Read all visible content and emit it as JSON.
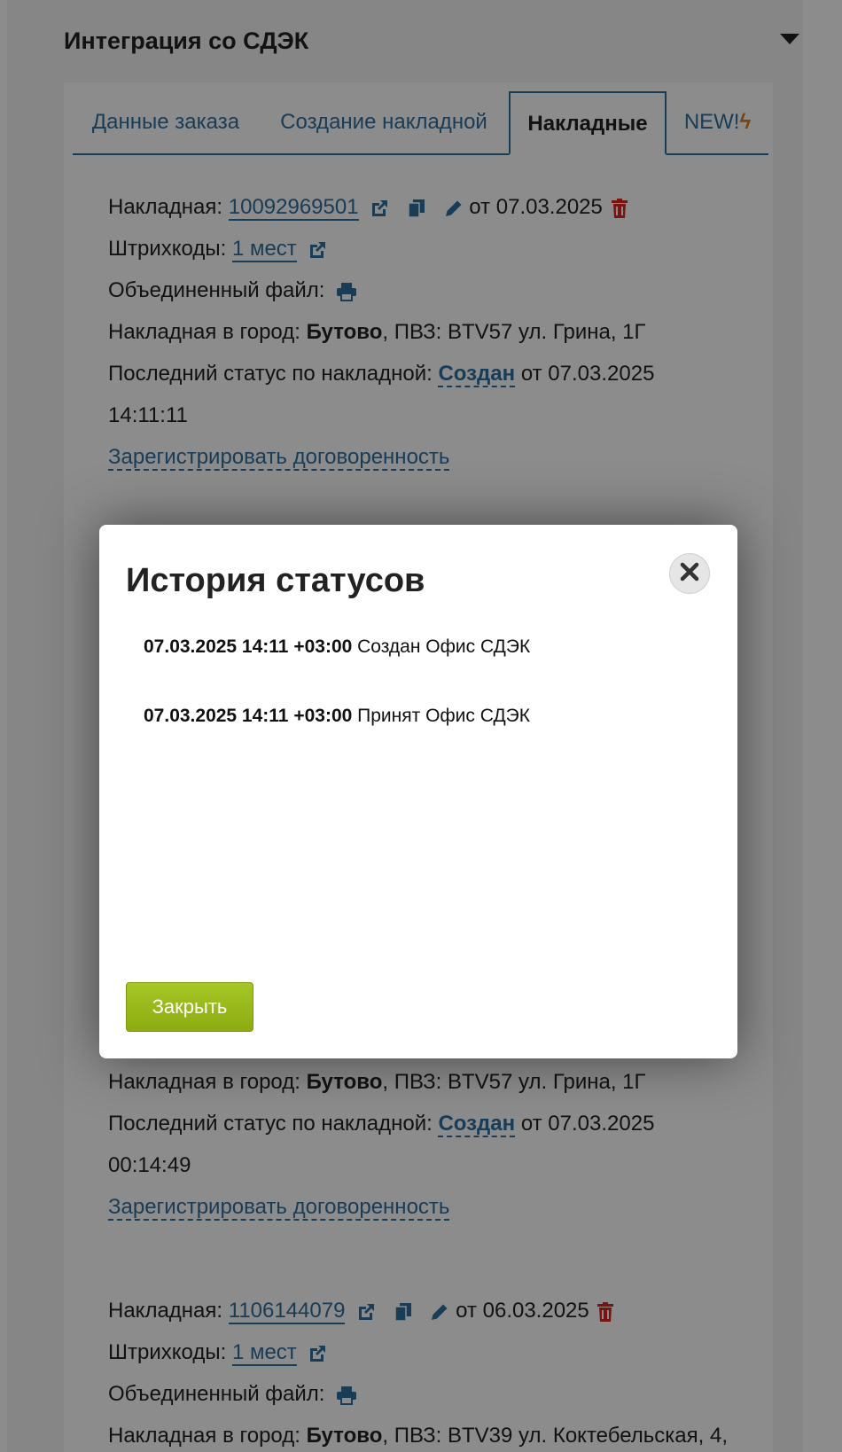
{
  "panel": {
    "title": "Интеграция со СДЭК"
  },
  "tabs": [
    {
      "label": "Данные заказа"
    },
    {
      "label": "Создание накладной"
    },
    {
      "label": "Накладные"
    },
    {
      "label": "NEW!"
    }
  ],
  "waybill1": {
    "label": "Накладная:",
    "number": "10092969501",
    "date_text": "от 07.03.2025",
    "barcodes_label": "Штрихкоды:",
    "barcodes_link": "1 мест",
    "merged_label": "Объединенный файл:",
    "city_label": "Накладная в город:",
    "city": "Бутово",
    "pvz_text": ", ПВЗ: BTV57 ул. Грина, 1Г",
    "status_label": "Последний статус по накладной:",
    "status": "Создан",
    "status_date": "от 07.03.2025",
    "status_time": "14:11:11",
    "register_link": "Зарегистрировать договоренность"
  },
  "waybill2": {
    "city_label": "Накладная в город:",
    "city": "Бутово",
    "pvz_text": ", ПВЗ: BTV57 ул. Грина, 1Г",
    "status_label": "Последний статус по накладной:",
    "status": "Создан",
    "status_date": "от 07.03.2025",
    "status_time": "00:14:49",
    "register_link": "Зарегистрировать договоренность"
  },
  "waybill3": {
    "label": "Накладная:",
    "number": "1106144079",
    "date_text": "от 06.03.2025",
    "barcodes_label": "Штрихкоды:",
    "barcodes_link": "1 мест",
    "merged_label": "Объединенный файл:",
    "city_label": "Накладная в город:",
    "city": "Бутово",
    "pvz_text": ", ПВЗ: BTV39 ул. Коктебельская, 4,"
  },
  "modal": {
    "title": "История статусов",
    "history": [
      {
        "datetime": "07.03.2025 14:11 +03:00",
        "text": "Создан Офис СДЭК"
      },
      {
        "datetime": "07.03.2025 14:11 +03:00",
        "text": "Принят Офис СДЭК"
      }
    ],
    "close_button": "Закрыть"
  },
  "colors": {
    "link": "#2e6d9e",
    "delete": "#d9261c",
    "bolt": "#e07a1f",
    "button": "#9cbc1a"
  }
}
